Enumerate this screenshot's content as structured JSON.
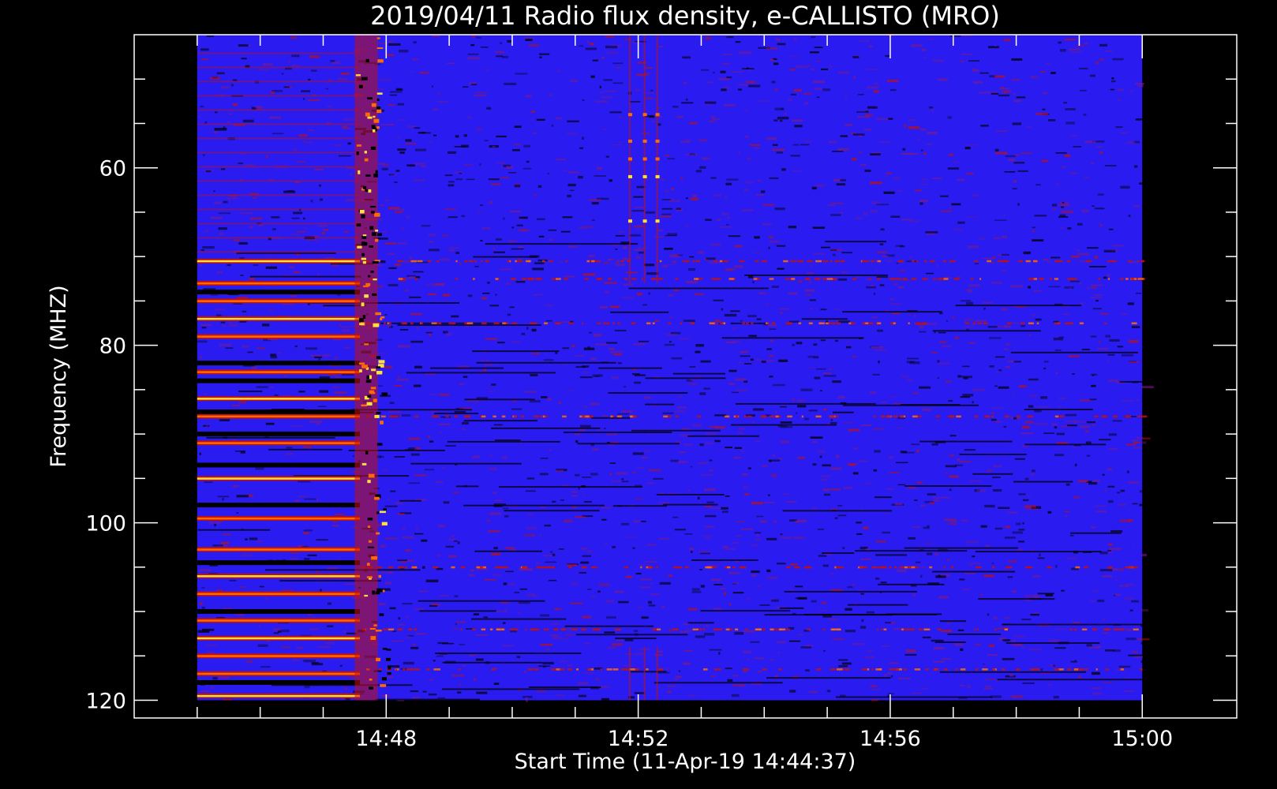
{
  "chart_data": {
    "type": "heatmap",
    "title": "2019/04/11  Radio flux density, e-CALLISTO (MRO)",
    "xlabel": "Start Time (11-Apr-19 14:44:37)",
    "ylabel": "Frequency (MHZ)",
    "x_ticks": [
      "14:48",
      "14:52",
      "14:56",
      "15:00"
    ],
    "y_ticks": [
      "60",
      "80",
      "100",
      "120"
    ],
    "xlim_minutes_after_1445": [
      -1.0,
      16.5
    ],
    "ylim_mhz": [
      45,
      122
    ],
    "y_axis_inverted": true,
    "data_extent": {
      "time_start": "14:45:00",
      "time_end": "15:00:00",
      "freq_min_mhz": 45,
      "freq_max_mhz": 120
    },
    "colormap": [
      "#000000",
      "#1a14ff",
      "#c01010",
      "#ff6a00",
      "#ffe040"
    ],
    "background_color": "#2a1cf0",
    "features": {
      "burst_times": [
        "14:47:30",
        "14:47:52"
      ],
      "interference_start": "14:45:00",
      "interference_end": "14:47:35",
      "strong_rfi_bands_mhz": [
        70.5,
        73,
        75,
        77,
        79,
        83,
        86,
        88,
        91,
        95,
        99.5,
        103,
        106,
        108,
        111,
        113,
        115,
        117,
        119.5
      ],
      "weak_rfi_bands_mhz": [
        70.5,
        72.5,
        77.5,
        88,
        105,
        112,
        116.5
      ],
      "vertical_blip_times": [
        "14:51:52",
        "14:52:06",
        "14:52:18"
      ]
    }
  }
}
